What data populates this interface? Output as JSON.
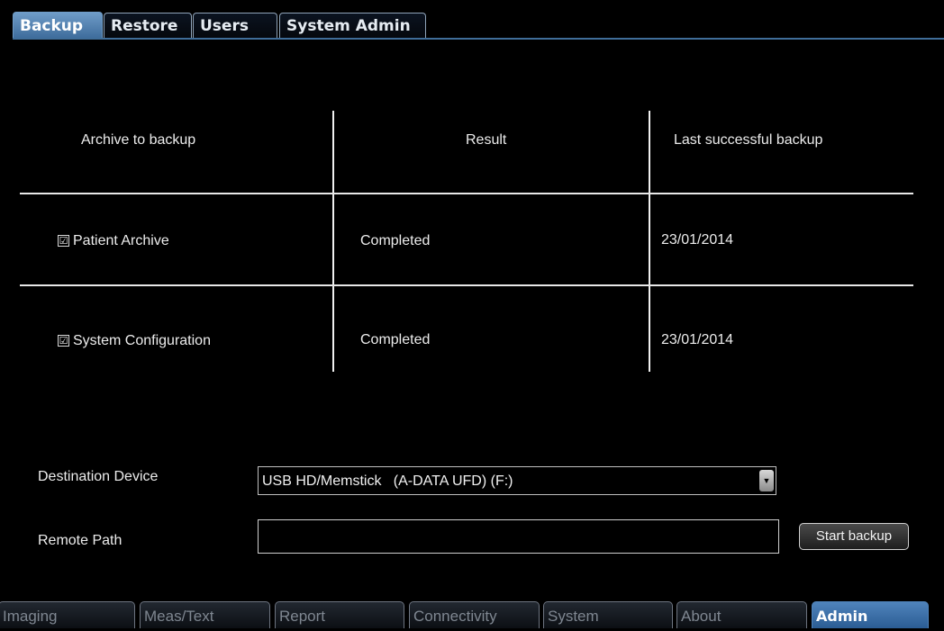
{
  "top_tabs": [
    {
      "label": "Backup",
      "active": true
    },
    {
      "label": "Restore",
      "active": false
    },
    {
      "label": "Users",
      "active": false
    },
    {
      "label": "System Admin",
      "active": false
    }
  ],
  "table": {
    "headers": [
      "Archive to backup",
      "Result",
      "Last successful backup"
    ],
    "rows": [
      {
        "checked": true,
        "archive": "Patient Archive",
        "result": "Completed",
        "last_backup": "23/01/2014"
      },
      {
        "checked": true,
        "archive": "System Configuration",
        "result": "Completed",
        "last_backup": "23/01/2014"
      }
    ]
  },
  "form": {
    "destination_label": "Destination Device",
    "destination_value": "USB HD/Memstick   (A-DATA UFD) (F:)",
    "remote_path_label": "Remote Path",
    "remote_path_value": "",
    "start_button": "Start backup"
  },
  "check_glyph": "☑",
  "bottom_tabs": [
    {
      "label": "Imaging",
      "active": false
    },
    {
      "label": "Meas/Text",
      "active": false
    },
    {
      "label": "Report",
      "active": false
    },
    {
      "label": "Connectivity",
      "active": false
    },
    {
      "label": "System",
      "active": false
    },
    {
      "label": "About",
      "active": false
    },
    {
      "label": "Admin",
      "active": true
    }
  ],
  "colors": {
    "accent": "#3d6b9b",
    "background": "#000000"
  }
}
